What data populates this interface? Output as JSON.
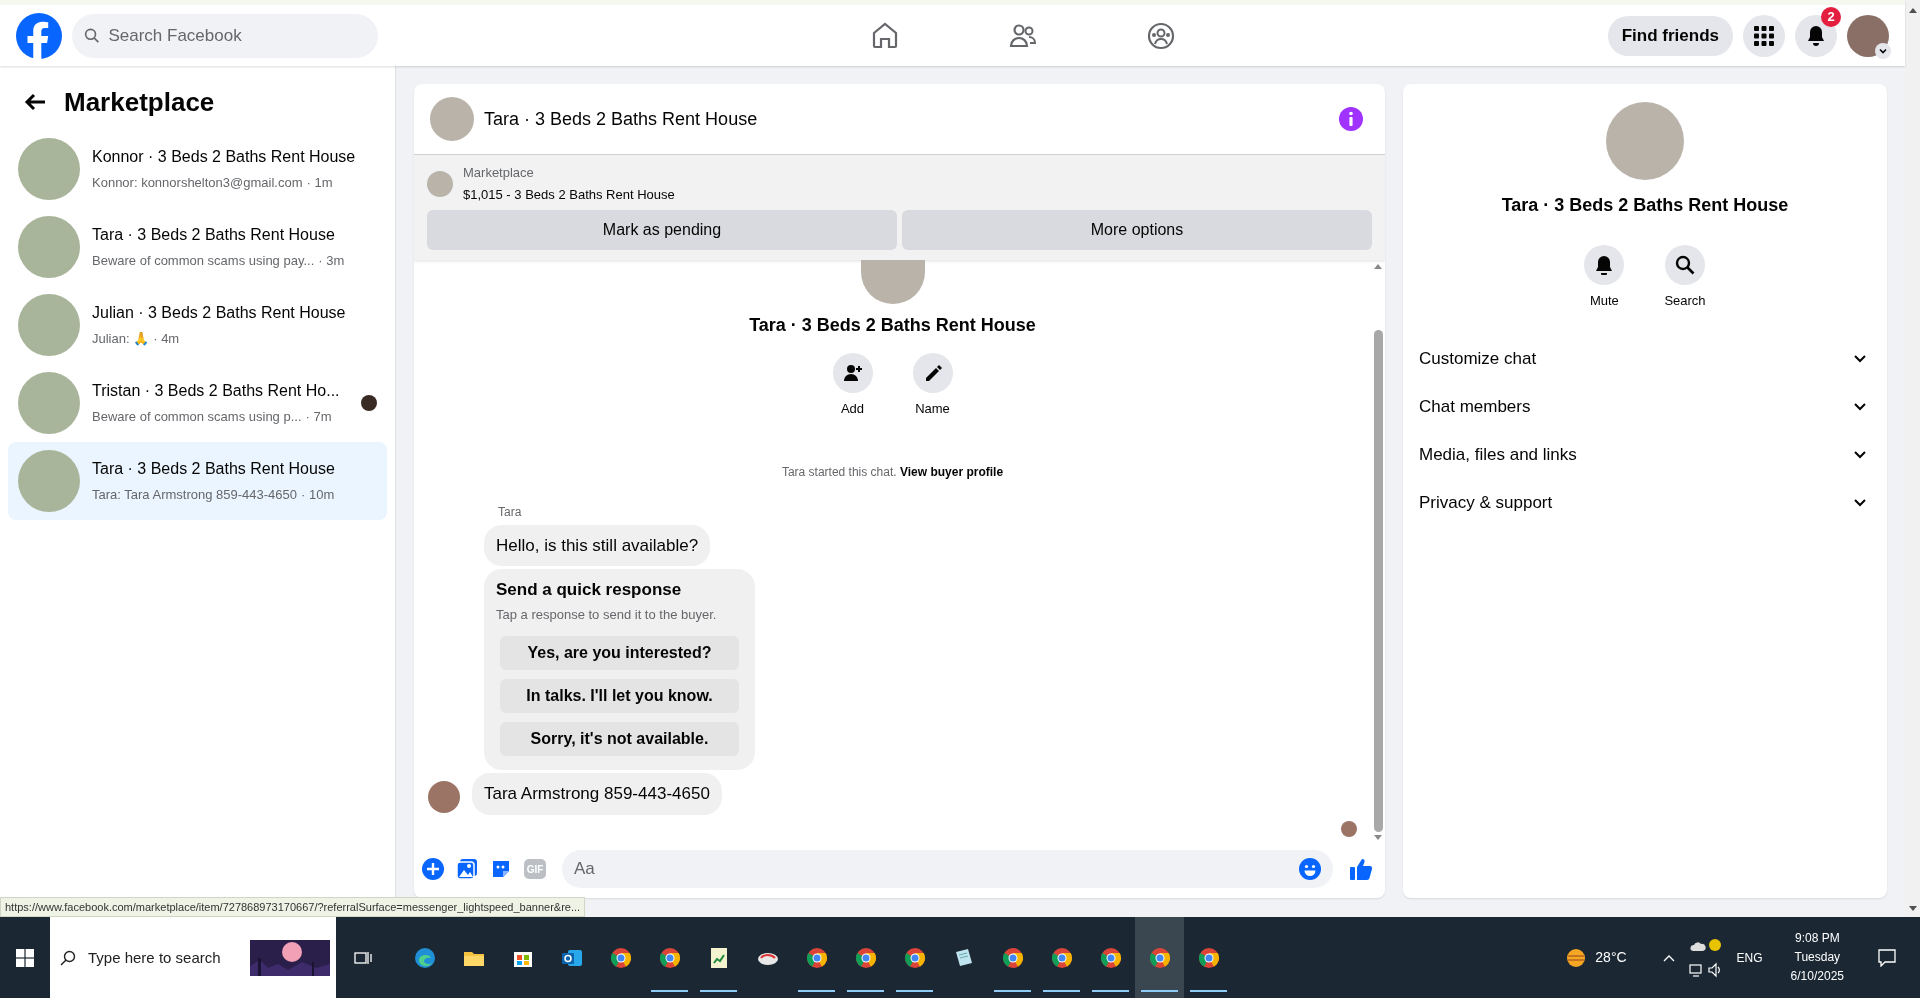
{
  "topbar": {
    "search": {
      "placeholder": "Search Facebook"
    },
    "nav": [
      {
        "kind": "home"
      },
      {
        "kind": "friends"
      },
      {
        "kind": "groups"
      }
    ],
    "find_friends": "Find friends",
    "notification_count": "2"
  },
  "sidebar": {
    "title": "Marketplace",
    "conversations": [
      {
        "title": "Konnor · 3 Beds 2 Baths Rent House",
        "preview": "Konnor: konnorshelton3@gmail.com",
        "time": "· 1m",
        "selected": false,
        "seen_avatar": false
      },
      {
        "title": "Tara · 3 Beds 2 Baths Rent House",
        "preview": "Beware of common scams using pay...",
        "time": "· 3m",
        "selected": false,
        "seen_avatar": false
      },
      {
        "title": "Julian · 3 Beds 2 Baths Rent House",
        "preview": "Julian: 🙏",
        "time": "· 4m",
        "selected": false,
        "seen_avatar": false
      },
      {
        "title": "Tristan · 3 Beds 2 Baths Rent Ho...",
        "preview": "Beware of common scams using p...",
        "time": "· 7m",
        "selected": false,
        "seen_avatar": true
      },
      {
        "title": "Tara · 3 Beds 2 Baths Rent House",
        "preview": "Tara: Tara Armstrong 859-443-4650",
        "time": "· 10m",
        "selected": true,
        "seen_avatar": false
      }
    ]
  },
  "chat": {
    "title": "Tara · 3 Beds 2 Baths Rent House",
    "listing": {
      "label": "Marketplace",
      "item": "$1,015 - 3 Beds 2 Baths Rent House",
      "buttons": [
        "Mark as pending",
        "More options"
      ]
    },
    "intro": {
      "title": "Tara · 3 Beds 2 Baths Rent House",
      "actions": [
        {
          "kind": "add",
          "label": "Add"
        },
        {
          "kind": "name",
          "label": "Name"
        }
      ]
    },
    "system_message": {
      "text": "Tara started this chat.",
      "link": "View buyer profile"
    },
    "sender": "Tara",
    "first_message": "Hello, is this still available?",
    "quick_response": {
      "title": "Send a quick response",
      "subtitle": "Tap a response to send it to the buyer.",
      "options": [
        "Yes, are you interested?",
        "In talks. I'll let you know.",
        "Sorry, it's not available."
      ]
    },
    "last_message": "Tara Armstrong 859-443-4650",
    "composer": {
      "placeholder": "Aa",
      "gif_label": "GIF"
    }
  },
  "details": {
    "title": "Tara · 3 Beds 2 Baths Rent House",
    "actions": [
      {
        "kind": "mute",
        "label": "Mute"
      },
      {
        "kind": "search",
        "label": "Search"
      }
    ],
    "sections": [
      {
        "label": "Customize chat",
        "expanded": false
      },
      {
        "label": "Chat members",
        "expanded": false
      },
      {
        "label": "Media, files and links",
        "expanded": false
      },
      {
        "label": "Privacy & support",
        "expanded": false
      }
    ]
  },
  "status_url": "https://www.facebook.com/marketplace/item/727868973170667/?referralSurface=messenger_lightspeed_banner&re...",
  "taskbar": {
    "search_placeholder": "Type here to search",
    "apps": [
      {
        "kind": "edge",
        "running": false,
        "selected": false
      },
      {
        "kind": "folder",
        "running": false,
        "selected": false
      },
      {
        "kind": "store",
        "running": false,
        "selected": false
      },
      {
        "kind": "mail",
        "running": false,
        "selected": false
      },
      {
        "kind": "chrome",
        "running": false,
        "selected": false
      },
      {
        "kind": "chrome",
        "running": true,
        "selected": false
      },
      {
        "kind": "sheet",
        "running": true,
        "selected": false
      },
      {
        "kind": "game",
        "running": false,
        "selected": false
      },
      {
        "kind": "chrome",
        "running": true,
        "selected": false
      },
      {
        "kind": "chrome",
        "running": true,
        "selected": false
      },
      {
        "kind": "chrome",
        "running": true,
        "selected": false
      },
      {
        "kind": "notes",
        "running": false,
        "selected": false
      },
      {
        "kind": "chrome",
        "running": true,
        "selected": false
      },
      {
        "kind": "chrome",
        "running": true,
        "selected": false
      },
      {
        "kind": "chrome",
        "running": true,
        "selected": false
      },
      {
        "kind": "chrome",
        "running": true,
        "selected": true
      },
      {
        "kind": "chrome",
        "running": true,
        "selected": false
      }
    ],
    "temperature": "28°C",
    "language": "ENG",
    "time": "9:08 PM",
    "day": "Tuesday",
    "date": "6/10/2025"
  }
}
